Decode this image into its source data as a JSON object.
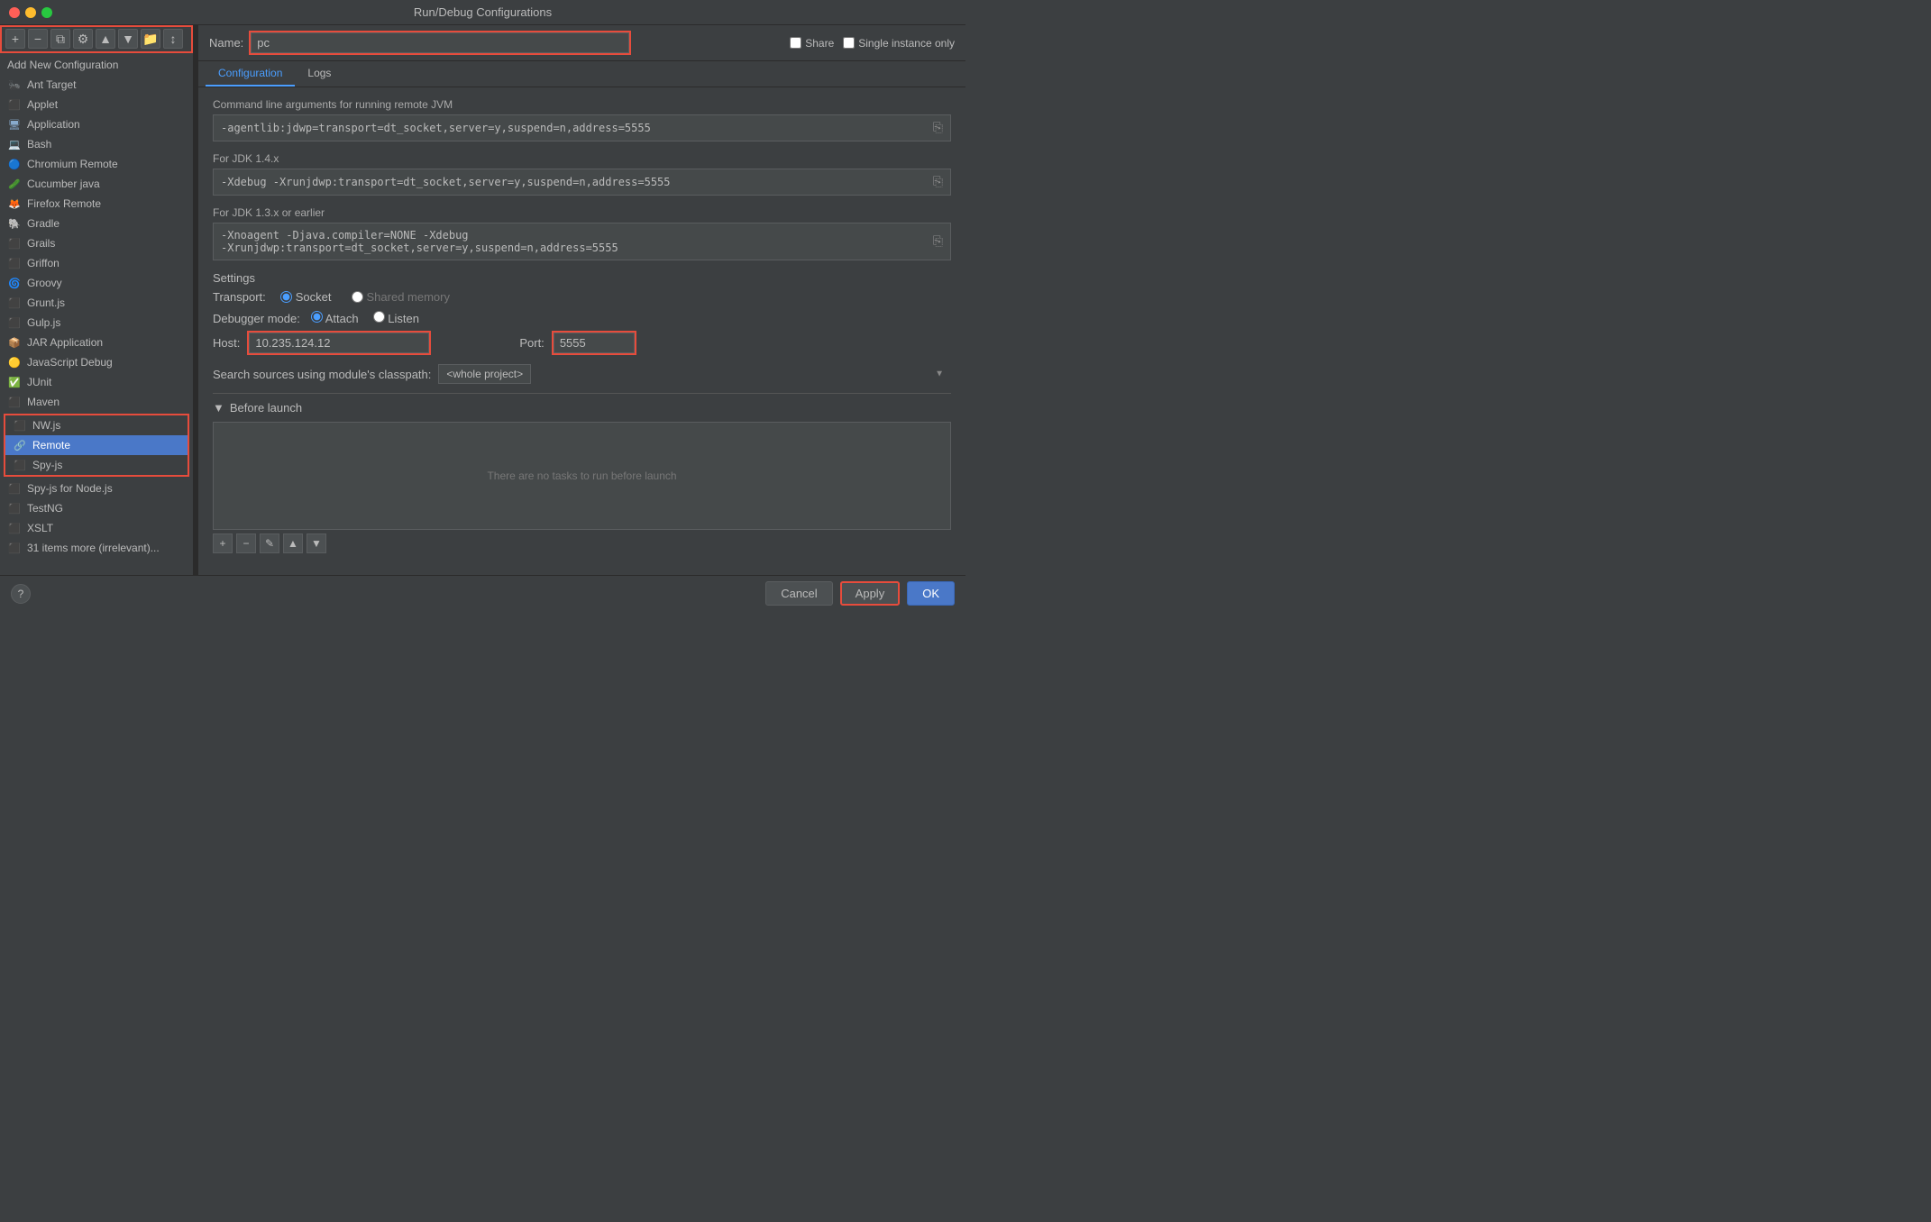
{
  "window": {
    "title": "Run/Debug Configurations"
  },
  "toolbar": {
    "add_label": "+",
    "remove_label": "−",
    "copy_label": "⧉",
    "settings_label": "⚙",
    "up_label": "▲",
    "down_label": "▼",
    "folder_label": "📁",
    "sort_label": "↕"
  },
  "sidebar": {
    "add_new_header": "Add New Configuration",
    "items": [
      {
        "label": "Ant Target",
        "icon": "🐜",
        "iconClass": "icon-ant"
      },
      {
        "label": "Applet",
        "icon": "⬛",
        "iconClass": "icon-applet"
      },
      {
        "label": "Application",
        "icon": "⬛",
        "iconClass": "icon-app"
      },
      {
        "label": "Bash",
        "icon": "⬛",
        "iconClass": "icon-bash"
      },
      {
        "label": "Chromium Remote",
        "icon": "⬛",
        "iconClass": "icon-chrome"
      },
      {
        "label": "Cucumber java",
        "icon": "⬛",
        "iconClass": "icon-cucumber"
      },
      {
        "label": "Firefox Remote",
        "icon": "⬛",
        "iconClass": "icon-firefox"
      },
      {
        "label": "Gradle",
        "icon": "⬛",
        "iconClass": "icon-gradle"
      },
      {
        "label": "Grails",
        "icon": "⬛",
        "iconClass": "icon-grails"
      },
      {
        "label": "Griffon",
        "icon": "⬛",
        "iconClass": "icon-griffon"
      },
      {
        "label": "Groovy",
        "icon": "⬛",
        "iconClass": "icon-groovy"
      },
      {
        "label": "Grunt.js",
        "icon": "⬛",
        "iconClass": "icon-grunt"
      },
      {
        "label": "Gulp.js",
        "icon": "⬛",
        "iconClass": "icon-gulp"
      },
      {
        "label": "JAR Application",
        "icon": "⬛",
        "iconClass": "icon-jar"
      },
      {
        "label": "JavaScript Debug",
        "icon": "⬛",
        "iconClass": "icon-jsdebug"
      },
      {
        "label": "JUnit",
        "icon": "⬛",
        "iconClass": "icon-junit"
      },
      {
        "label": "Maven",
        "icon": "⬛",
        "iconClass": "icon-maven"
      },
      {
        "label": "NW.js",
        "icon": "⬛",
        "iconClass": "icon-nwjs"
      },
      {
        "label": "Remote",
        "icon": "⬛",
        "iconClass": "icon-remote",
        "selected": true
      },
      {
        "label": "Spy-js",
        "icon": "⬛",
        "iconClass": "icon-spyjs"
      },
      {
        "label": "Spy-js for Node.js",
        "icon": "⬛",
        "iconClass": "icon-spyjs"
      },
      {
        "label": "TestNG",
        "icon": "⬛",
        "iconClass": "icon-testng"
      },
      {
        "label": "XSLT",
        "icon": "⬛",
        "iconClass": "icon-xslt"
      },
      {
        "label": "31 items more (irrelevant)...",
        "icon": "",
        "iconClass": ""
      }
    ]
  },
  "name_field": {
    "label": "Name:",
    "value": "pc"
  },
  "share": {
    "share_label": "Share",
    "single_instance_label": "Single instance only"
  },
  "tabs": [
    {
      "label": "Configuration",
      "active": true
    },
    {
      "label": "Logs",
      "active": false
    }
  ],
  "config": {
    "cmd_args_label": "Command line arguments for running remote JVM",
    "cmd_args_value": "-agentlib:jdwp=transport=dt_socket,server=y,suspend=n,address=5555",
    "jdk14_label": "For JDK 1.4.x",
    "jdk14_value": "-Xdebug -Xrunjdwp:transport=dt_socket,server=y,suspend=n,address=5555",
    "jdk13_label": "For JDK 1.3.x or earlier",
    "jdk13_value": "-Xnoagent -Djava.compiler=NONE -Xdebug\n-Xrunjdwp:transport=dt_socket,server=y,suspend=n,address=5555",
    "settings_label": "Settings",
    "transport_label": "Transport:",
    "transport_socket": "Socket",
    "transport_shared": "Shared memory",
    "debugger_mode_label": "Debugger mode:",
    "debugger_attach": "Attach",
    "debugger_listen": "Listen",
    "host_label": "Host:",
    "host_value": "10.235.124.12",
    "port_label": "Port:",
    "port_value": "5555",
    "classpath_label": "Search sources using module's classpath:",
    "classpath_value": "<whole project>",
    "before_launch_label": "Before launch",
    "before_launch_empty": "There are no tasks to run before launch"
  },
  "bottom": {
    "help_label": "?",
    "cancel_label": "Cancel",
    "apply_label": "Apply",
    "ok_label": "OK"
  }
}
